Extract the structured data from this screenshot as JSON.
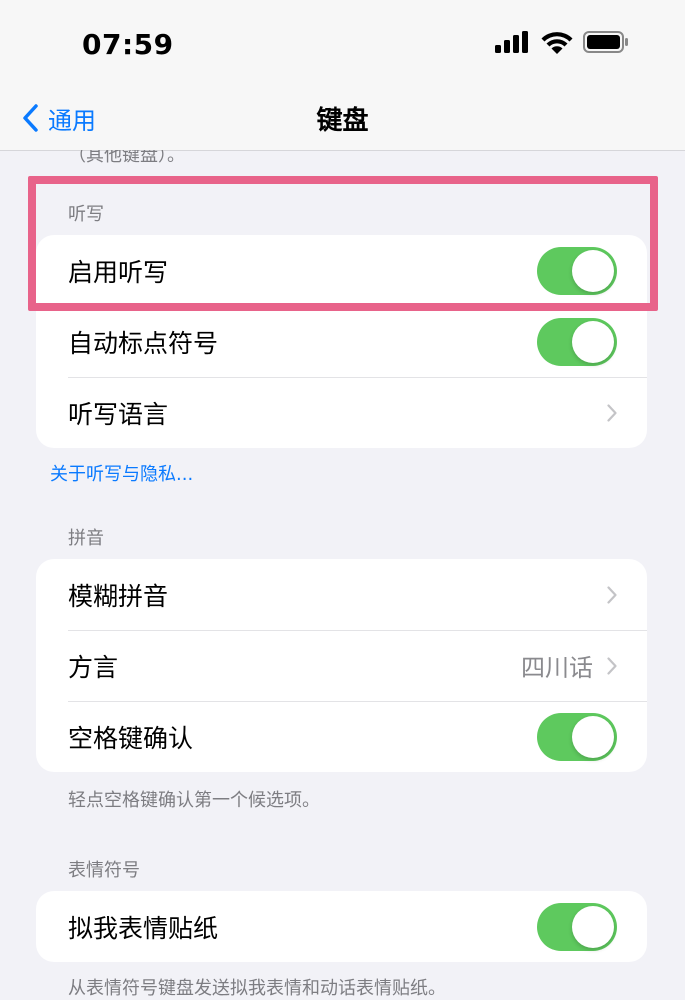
{
  "status_bar": {
    "time": "07:59",
    "icons": [
      "cellular-signal-icon",
      "wifi-icon",
      "battery-icon"
    ]
  },
  "nav": {
    "back_label": "通用",
    "title": "键盘"
  },
  "clipped_note": "（其他键盘）。",
  "dictation": {
    "header": "听写",
    "rows": [
      {
        "label": "启用听写",
        "type": "toggle",
        "on": true
      },
      {
        "label": "自动标点符号",
        "type": "toggle",
        "on": true
      },
      {
        "label": "听写语言",
        "type": "chevron"
      }
    ],
    "privacy_link": "关于听写与隐私..."
  },
  "pinyin": {
    "header": "拼音",
    "rows": [
      {
        "label": "模糊拼音",
        "type": "chevron"
      },
      {
        "label": "方言",
        "type": "chevron",
        "value": "四川话"
      },
      {
        "label": "空格键确认",
        "type": "toggle",
        "on": true
      }
    ],
    "footer": "轻点空格键确认第一个候选项。"
  },
  "emoji": {
    "header": "表情符号",
    "rows": [
      {
        "label": "拟我表情贴纸",
        "type": "toggle",
        "on": true
      }
    ],
    "footer": "从表情符号键盘发送拟我表情和动话表情贴纸。"
  },
  "colors": {
    "accent": "#0a7aff",
    "toggle_on": "#5ec95e",
    "highlight": "#e8638a",
    "background": "#f2f2f7"
  }
}
